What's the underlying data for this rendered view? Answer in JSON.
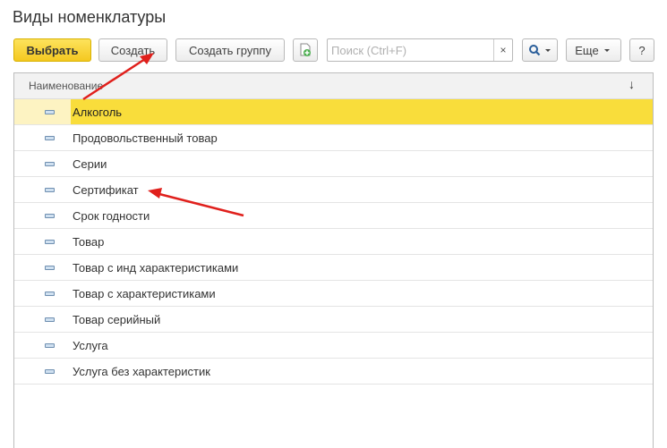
{
  "page": {
    "title": "Виды номенклатуры"
  },
  "toolbar": {
    "select_label": "Выбрать",
    "create_label": "Создать",
    "create_group_label": "Создать группу",
    "search_placeholder": "Поиск (Ctrl+F)",
    "clear_symbol": "×",
    "more_label": "Еще",
    "help_label": "?"
  },
  "grid": {
    "column_header": "Наименование",
    "sort_symbol": "↓",
    "rows": [
      "Алкоголь",
      "Продовольственный товар",
      "Серии",
      "Сертификат",
      "Срок годности",
      "Товар",
      "Товар с инд характеристиками",
      "Товар с характеристиками",
      "Товар серийный",
      "Услуга",
      "Услуга без характеристик"
    ],
    "selected_index": 0
  },
  "colors": {
    "primary_button": "#f4c820",
    "selected_row": "#f9dd3b",
    "annotation_arrow": "#e0201c"
  },
  "icons": [
    "copy-add-icon",
    "search-icon",
    "dropdown-icon",
    "row-item-icon"
  ]
}
